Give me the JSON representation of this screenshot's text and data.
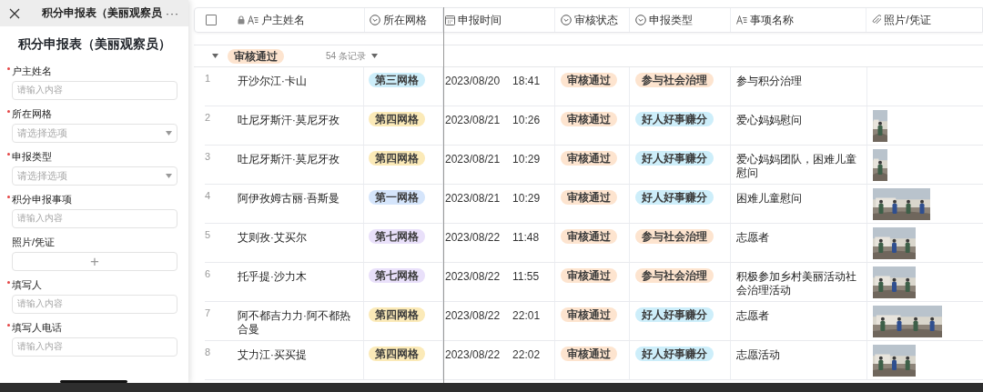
{
  "form_panel": {
    "title_bar": {
      "title": "积分申报表（美丽观察员",
      "more": "···"
    },
    "form_title": "积分申报表（美丽观察员）",
    "fields": [
      {
        "label": "户主姓名",
        "required": true,
        "kind": "text",
        "placeholder": "请输入内容"
      },
      {
        "label": "所在网格",
        "required": true,
        "kind": "select",
        "placeholder": "请选择选项"
      },
      {
        "label": "申报类型",
        "required": true,
        "kind": "select",
        "placeholder": "请选择选项"
      },
      {
        "label": "积分申报事项",
        "required": true,
        "kind": "text",
        "placeholder": "请输入内容"
      },
      {
        "label": "照片/凭证",
        "required": false,
        "kind": "upload",
        "button": "+"
      },
      {
        "label": "填写人",
        "required": true,
        "kind": "text",
        "placeholder": "请输入内容"
      },
      {
        "label": "填写人电话",
        "required": true,
        "kind": "text",
        "placeholder": "请输入内容"
      }
    ]
  },
  "table": {
    "select_all": {
      "checked": false
    },
    "columns": [
      {
        "label": "户主姓名",
        "kind": "text",
        "locked": true
      },
      {
        "label": "所在网格",
        "kind": "option",
        "locked": false
      },
      {
        "label": "申报时间",
        "kind": "date",
        "locked": false
      },
      {
        "label": "审核状态",
        "kind": "option",
        "locked": false
      },
      {
        "label": "申报类型",
        "kind": "option",
        "locked": false
      },
      {
        "label": "事项名称",
        "kind": "text",
        "locked": false
      },
      {
        "label": "照片/凭证",
        "kind": "attachment",
        "locked": false
      }
    ],
    "group": {
      "label": "审核通过",
      "color": "#fde4cf",
      "count": "54 条记录",
      "expanded": true
    },
    "rows": [
      {
        "index": "1",
        "name": "开沙尔江·卡山",
        "grid": {
          "label": "第三网格",
          "color": "#cdeefa"
        },
        "date": "2023/08/20",
        "time": "18:41",
        "status": {
          "label": "审核通过",
          "color": "#fde4cf"
        },
        "type": {
          "label": "参与社会治理",
          "color": "#fde4cf"
        },
        "item": "参与积分治理"
      },
      {
        "index": "2",
        "name": "吐尼牙斯汗·莫尼牙孜",
        "grid": {
          "label": "第四网格",
          "color": "#fbeab8"
        },
        "date": "2023/08/21",
        "time": "10:26",
        "status": {
          "label": "审核通过",
          "color": "#fde4cf"
        },
        "type": {
          "label": "好人好事赚分",
          "color": "#cdeefa"
        },
        "item": "爱心妈妈慰问"
      },
      {
        "index": "3",
        "name": "吐尼牙斯汗·莫尼牙孜",
        "grid": {
          "label": "第四网格",
          "color": "#fbeab8"
        },
        "date": "2023/08/21",
        "time": "10:29",
        "status": {
          "label": "审核通过",
          "color": "#fde4cf"
        },
        "type": {
          "label": "好人好事赚分",
          "color": "#cdeefa"
        },
        "item": "爱心妈妈团队，困难儿童慰问"
      },
      {
        "index": "4",
        "name": "阿伊孜姆古丽·吾斯曼",
        "grid": {
          "label": "第一网格",
          "color": "#d5e5fb"
        },
        "date": "2023/08/21",
        "time": "10:29",
        "status": {
          "label": "审核通过",
          "color": "#fde4cf"
        },
        "type": {
          "label": "好人好事赚分",
          "color": "#cdeefa"
        },
        "item": "困难儿童慰问"
      },
      {
        "index": "5",
        "name": "艾则孜·艾买尔",
        "grid": {
          "label": "第七网格",
          "color": "#e9e0fa"
        },
        "date": "2023/08/22",
        "time": "11:48",
        "status": {
          "label": "审核通过",
          "color": "#fde4cf"
        },
        "type": {
          "label": "参与社会治理",
          "color": "#fde4cf"
        },
        "item": "志愿者"
      },
      {
        "index": "6",
        "name": "托乎提·沙力木",
        "grid": {
          "label": "第七网格",
          "color": "#e9e0fa"
        },
        "date": "2023/08/22",
        "time": "11:55",
        "status": {
          "label": "审核通过",
          "color": "#fde4cf"
        },
        "type": {
          "label": "参与社会治理",
          "color": "#fde4cf"
        },
        "item": "积极参加乡村美丽活动社会治理活动"
      },
      {
        "index": "7",
        "name": "阿不都吉力力·阿不都热合曼",
        "grid": {
          "label": "第四网格",
          "color": "#fbeab8"
        },
        "date": "2023/08/22",
        "time": "22:01",
        "status": {
          "label": "审核通过",
          "color": "#fde4cf"
        },
        "type": {
          "label": "好人好事赚分",
          "color": "#cdeefa"
        },
        "item": "志愿者"
      },
      {
        "index": "8",
        "name": "艾力江·买买提",
        "grid": {
          "label": "第四网格",
          "color": "#fbeab8"
        },
        "date": "2023/08/22",
        "time": "22:02",
        "status": {
          "label": "审核通过",
          "color": "#fde4cf"
        },
        "type": {
          "label": "好人好事赚分",
          "color": "#cdeefa"
        },
        "item": "志愿活动"
      }
    ]
  }
}
